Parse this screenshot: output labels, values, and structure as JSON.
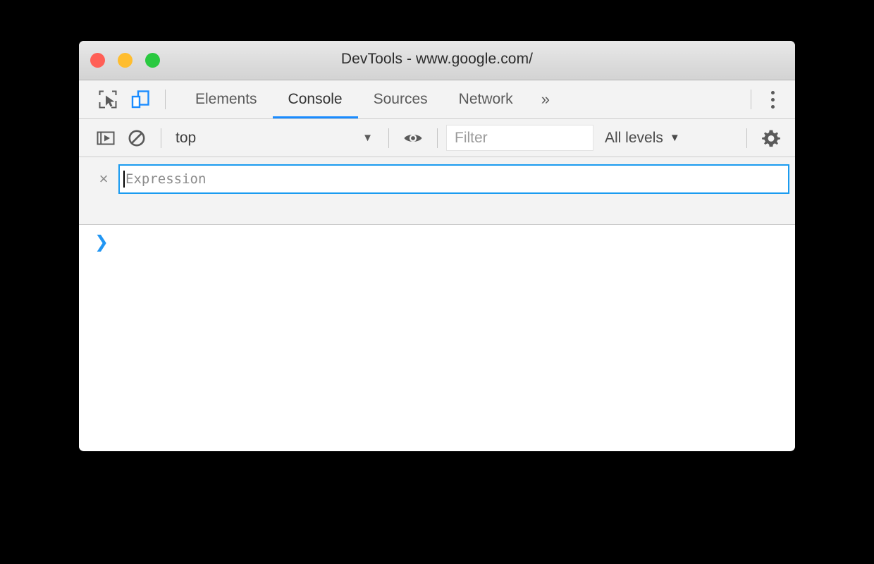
{
  "window": {
    "title": "DevTools - www.google.com/",
    "traffic_lights": [
      {
        "name": "close",
        "color": "#ff5f56"
      },
      {
        "name": "minimize",
        "color": "#ffbd2e"
      },
      {
        "name": "maximize",
        "color": "#2ac940"
      }
    ]
  },
  "tabbar": {
    "inspect_icon": "inspect-element-icon",
    "device_icon": "device-toolbar-icon",
    "tabs": [
      {
        "label": "Elements",
        "active": false
      },
      {
        "label": "Console",
        "active": true
      },
      {
        "label": "Sources",
        "active": false
      },
      {
        "label": "Network",
        "active": false
      }
    ],
    "more_tabs_label": "»",
    "menu_icon": "kebab-menu-icon",
    "active_underline_color": "#1a8cff"
  },
  "console_toolbar": {
    "sidebar_toggle_icon": "console-sidebar-toggle-icon",
    "clear_icon": "clear-console-icon",
    "context": {
      "value": "top",
      "caret": "▼"
    },
    "eye_icon": "live-expression-eye-icon",
    "filter": {
      "placeholder": "Filter",
      "value": ""
    },
    "levels": {
      "label": "All levels",
      "caret": "▼"
    },
    "settings_icon": "settings-gear-icon"
  },
  "live_expression": {
    "remove_label": "×",
    "placeholder": "Expression",
    "value": "",
    "focused": true,
    "focus_border_color": "#1a9bf0"
  },
  "console_output": {
    "prompt": "❯",
    "prompt_color": "#2196f3",
    "messages": []
  }
}
